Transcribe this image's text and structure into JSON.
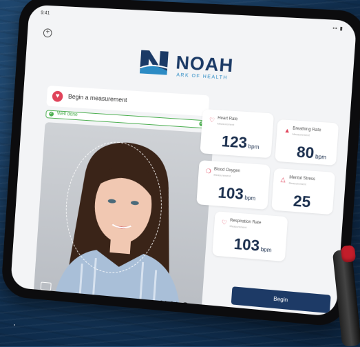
{
  "status_bar": {
    "time": "9:41",
    "icons": "▪▪ ▮"
  },
  "logo": {
    "name": "NOAH",
    "tagline": "ARK OF HEALTH"
  },
  "measurement": {
    "label": "Begin a measurement",
    "progress_text": "Well done",
    "progress_percent": 100
  },
  "timer": {
    "value": "01:04"
  },
  "metrics": [
    {
      "name": "Heart Rate",
      "sub": "Measurement",
      "value": "123",
      "unit": "bpm"
    },
    {
      "name": "Breathing Rate",
      "sub": "Measurement",
      "value": "80",
      "unit": "bpm"
    },
    {
      "name": "Blood Oxygen",
      "sub": "Measurement",
      "value": "103",
      "unit": "bpm"
    },
    {
      "name": "Mental Stress",
      "sub": "Measurement",
      "value": "25",
      "unit": ""
    },
    {
      "name": "Respiration Rate",
      "sub": "Measurement",
      "value": "103",
      "unit": "bpm"
    }
  ],
  "begin_button": {
    "label": "Begin"
  },
  "colors": {
    "brand": "#1b3a66",
    "accent": "#2c8bc4",
    "success": "#4caf50",
    "alert": "#e0435a"
  },
  "icons": {
    "add": "add-circle-icon",
    "heart": "heart-icon",
    "check": "check-icon",
    "camera_flip": "camera-flip-icon",
    "timer": "timer-icon"
  }
}
